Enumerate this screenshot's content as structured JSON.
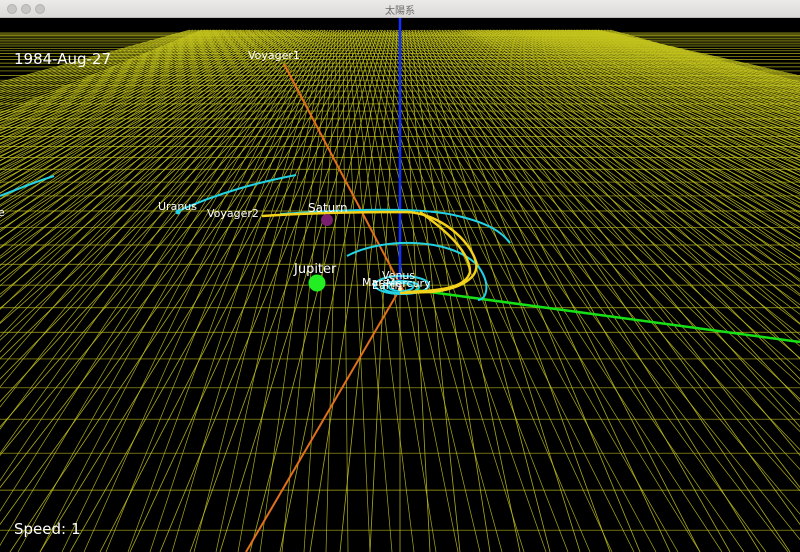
{
  "window": {
    "title": "太陽系"
  },
  "hud": {
    "date": "1984-Aug-27",
    "speed_label": "Speed:",
    "speed_value": "1"
  },
  "bodies": [
    {
      "name": "Voyager1",
      "kind": "probe"
    },
    {
      "name": "Uranus",
      "kind": "planet"
    },
    {
      "name": "Voyager2",
      "kind": "probe"
    },
    {
      "name": "Saturn",
      "kind": "planet"
    },
    {
      "name": "Jupiter",
      "kind": "planet"
    },
    {
      "name": "Venus",
      "kind": "planet"
    },
    {
      "name": "Mars",
      "kind": "planet"
    },
    {
      "name": "Earth",
      "kind": "planet"
    },
    {
      "name": "Mercury",
      "kind": "planet"
    },
    {
      "name": "e",
      "kind": "planet"
    }
  ],
  "colors": {
    "grid": "#c8c81e",
    "orbit": "#22d3e6",
    "probe_path": "#f5d21a",
    "axis_x": "#16e016",
    "axis_y": "#e0701c",
    "axis_z": "#1030ff",
    "jupiter": "#22ee22",
    "saturn": "#7a1f6e",
    "uranus": "#22d3e6"
  }
}
